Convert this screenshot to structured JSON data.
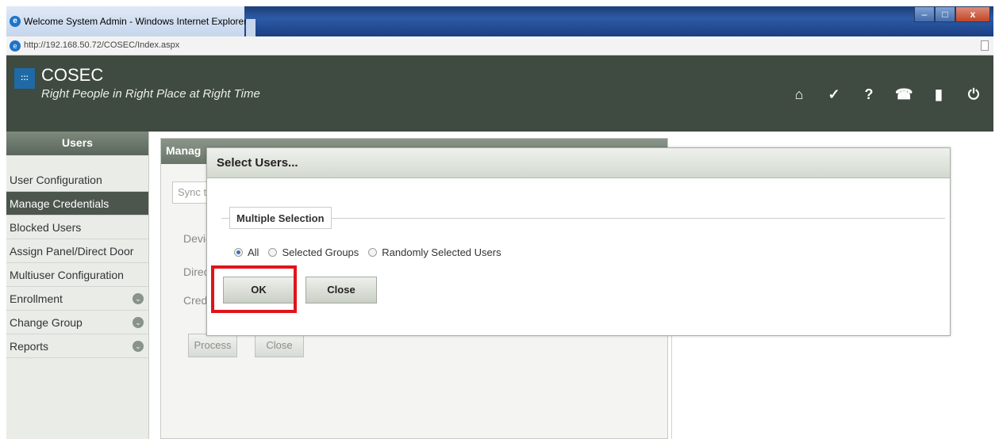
{
  "browser": {
    "window_title": "Welcome System Admin - Windows Internet Explorer",
    "url": "http://192.168.50.72/COSEC/Index.aspx",
    "controls": {
      "minimize": "–",
      "maximize": "□",
      "close": "x"
    }
  },
  "app": {
    "name": "COSEC",
    "tagline": "Right People in Right Place at Right Time",
    "header_icons": [
      "home-icon",
      "tools-icon",
      "help-icon",
      "phone-icon",
      "info-icon",
      "power-icon"
    ]
  },
  "sidebar": {
    "title": "Users",
    "items": [
      {
        "label": "User Configuration",
        "active": false
      },
      {
        "label": "Manage Credentials",
        "active": true
      },
      {
        "label": "Blocked Users",
        "active": false
      },
      {
        "label": "Assign Panel/Direct Door",
        "active": false
      },
      {
        "label": "Multiuser Configuration",
        "active": false
      },
      {
        "label": "Enrollment",
        "active": false,
        "expandable": true
      },
      {
        "label": "Change Group",
        "active": false,
        "expandable": true
      },
      {
        "label": "Reports",
        "active": false,
        "expandable": true
      }
    ]
  },
  "background_panel": {
    "title": "Manag",
    "tab": "Sync t",
    "labels": [
      "Devic",
      "Direc",
      "Crede"
    ],
    "buttons": {
      "process": "Process",
      "close": "Close"
    }
  },
  "dialog": {
    "title": "Select Users...",
    "group_label": "Multiple Selection",
    "options": [
      {
        "label": "All",
        "checked": true
      },
      {
        "label": "Selected Groups",
        "checked": false
      },
      {
        "label": "Randomly Selected Users",
        "checked": false
      }
    ],
    "ok_label": "OK",
    "close_label": "Close"
  },
  "colors": {
    "header_bg": "#3f4a40",
    "sidebar_active": "#4d564d",
    "highlight": "#e0141b"
  }
}
